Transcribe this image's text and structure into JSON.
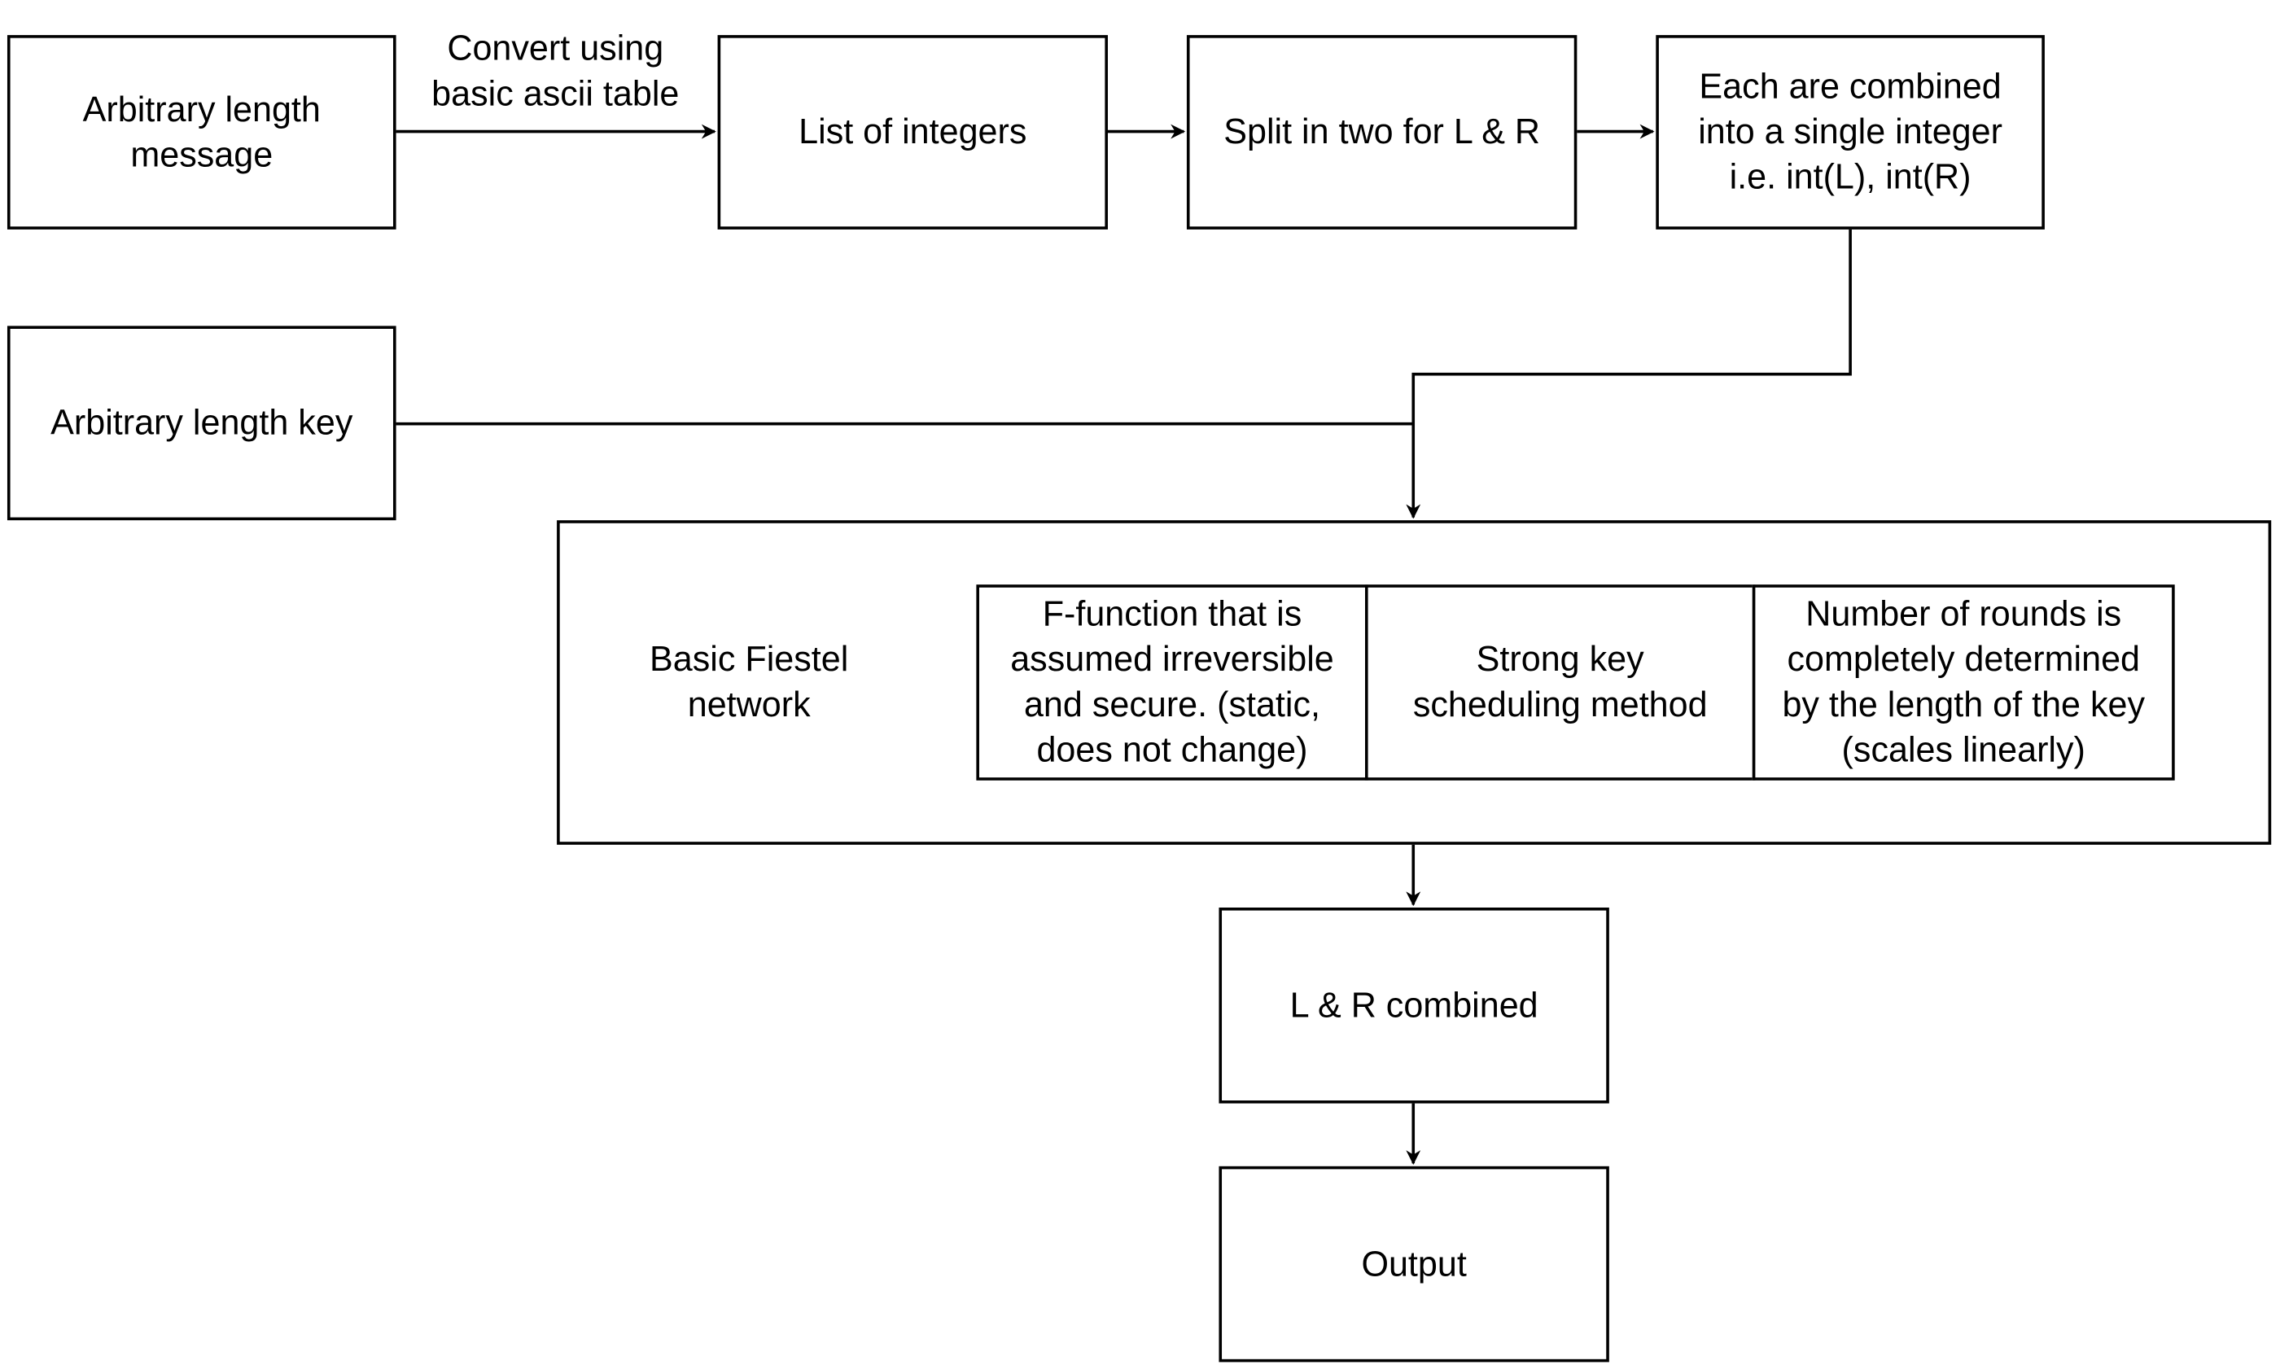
{
  "nodes": {
    "message": "Arbitrary length\nmessage",
    "integers": "List of integers",
    "split": "Split in two for L & R",
    "combine": "Each are combined\ninto a single integer\ni.e. int(L), int(R)",
    "key": "Arbitrary length key",
    "fiestel": "Basic Fiestel\nnetwork",
    "ffunction": "F-function that is\nassumed irreversible\nand secure. (static,\ndoes not change)",
    "keyschedule": "Strong key\nscheduling method",
    "rounds": "Number of rounds is\ncompletely determined\nby the length of the key\n(scales linearly)",
    "lr_combined": "L & R combined",
    "output": "Output"
  },
  "edges": {
    "convert_label": "Convert using\nbasic ascii table"
  },
  "colors": {
    "stroke": "#000000",
    "background": "#ffffff"
  }
}
